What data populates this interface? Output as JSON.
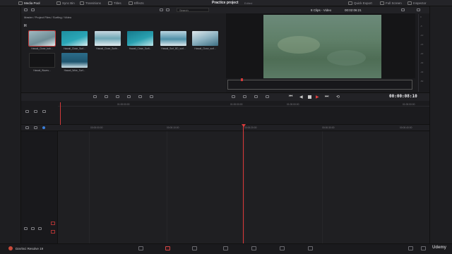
{
  "topbar": {
    "items": [
      {
        "label": "Media Pool",
        "active": true
      },
      {
        "label": "Sync Bin"
      },
      {
        "label": "Transitions"
      },
      {
        "label": "Titles"
      },
      {
        "label": "Effects"
      }
    ],
    "project_title": "Practice project",
    "project_status": "Edited",
    "right_items": [
      {
        "label": "Quick Export"
      },
      {
        "label": "Full Screen"
      },
      {
        "label": "Inspector"
      }
    ]
  },
  "toolbar": {
    "search_placeholder": "Search"
  },
  "media_pool": {
    "breadcrumb": "Master / Project Files / Surfing / Video",
    "bin_group_label": "H",
    "clips": [
      {
        "name": "Hawaii_Close_trah...",
        "selected": true
      },
      {
        "name": "Hawaii_Close_Surf..."
      },
      {
        "name": "Hawaii_Close_Surfe..."
      },
      {
        "name": "Hawaii_Close_Surfi..."
      },
      {
        "name": "Hawaii_Surf_BD_surf..."
      },
      {
        "name": "Hawaii_Close_surf..."
      },
      {
        "name": "Hawaii_Waves..."
      },
      {
        "name": "Hawaii_Wide_Surf..."
      }
    ]
  },
  "viewer": {
    "clip_count": "8 Clips - Video",
    "source_time": "00:02:06:21"
  },
  "transport": {
    "timecode": "00:00:08:10",
    "tooltip": "Stop"
  },
  "meters": {
    "labels": [
      "0",
      "-5",
      "-10",
      "-15",
      "-20",
      "-30",
      "-40",
      "-50"
    ]
  },
  "timeline": {
    "mini_ruler_ticks": [
      "01:00:00:00",
      "01:00:00:00",
      "01:00:00:00",
      "01:00:00:00"
    ],
    "ruler_ticks": [
      "00:00:00:00",
      "00:00:10:00",
      "00:00:20:00",
      "00:00:30:00",
      "00:00:40:00"
    ]
  },
  "bottombar": {
    "app_name": "DaVinci Resolve 19",
    "watermark": "Udemy"
  },
  "colors": {
    "accent": "#d23a3a",
    "background": "#1b1b1e"
  }
}
